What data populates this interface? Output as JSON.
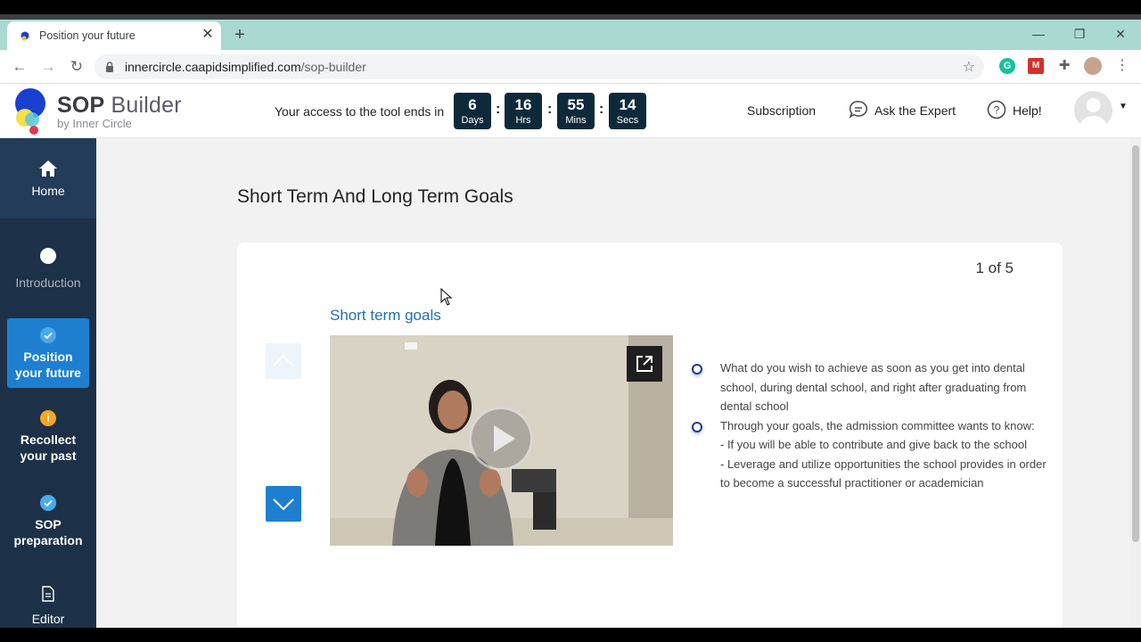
{
  "browser": {
    "tab_title": "Position your future",
    "tab_close": "✕",
    "new_tab": "+",
    "url_domain": "innercircle.caapidsimplified.com",
    "url_path": "/sop-builder",
    "extensions": {
      "grammarly": "G",
      "m": "M"
    }
  },
  "header": {
    "logo_title_bold": "SOP",
    "logo_title_rest": " Builder",
    "logo_sub": "by Inner Circle",
    "access_text": "Your access to the tool ends in",
    "countdown": [
      {
        "num": "6",
        "unit": "Days"
      },
      {
        "num": "16",
        "unit": "Hrs"
      },
      {
        "num": "55",
        "unit": "Mins"
      },
      {
        "num": "14",
        "unit": "Secs"
      }
    ],
    "separator": ":",
    "subscription": "Subscription",
    "ask_expert": "Ask the Expert",
    "help": "Help!"
  },
  "sidebar": {
    "items": [
      {
        "label": "Home"
      },
      {
        "label": "Introduction"
      },
      {
        "label_line1": "Position",
        "label_line2": "your future"
      },
      {
        "label_line1": "Recollect",
        "label_line2": "your past",
        "badge": "i"
      },
      {
        "label_line1": "SOP",
        "label_line2": "preparation"
      },
      {
        "label": "Editor"
      }
    ]
  },
  "main": {
    "page_title": "Short Term And Long Term Goals",
    "page_counter": "1 of 5",
    "section_title": "Short term goals",
    "bullets": [
      {
        "text": "What do you wish to achieve as soon as you get into dental school, during dental school, and right after graduating from dental school"
      },
      {
        "line1": "Through your goals, the admission committee wants to know:",
        "line2": "- If you will be able to contribute and give back to the school",
        "line3": "- Leverage and utilize opportunities the school provides in order to become a successful practitioner or academician"
      }
    ]
  },
  "colors": {
    "sidebar_bg": "#1c3148",
    "active_item": "#1e7fd1",
    "countdown_bg": "#0e2a3a",
    "section_title": "#1f6fb8",
    "tab_strip": "#a9d9d1"
  }
}
